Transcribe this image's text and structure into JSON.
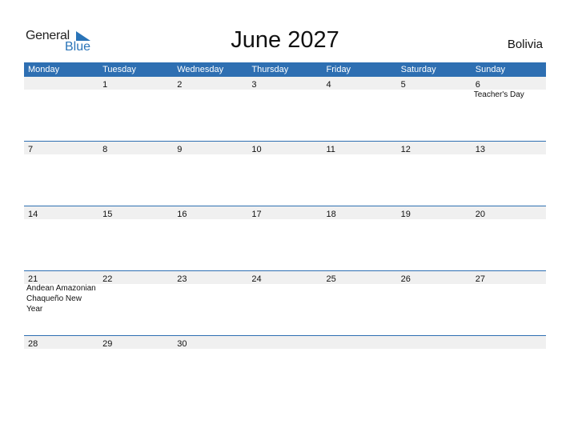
{
  "logo": {
    "general": "General",
    "blue": "Blue"
  },
  "title": "June 2027",
  "country": "Bolivia",
  "accent_color": "#2e6fb2",
  "weekdays": [
    "Monday",
    "Tuesday",
    "Wednesday",
    "Thursday",
    "Friday",
    "Saturday",
    "Sunday"
  ],
  "weeks": [
    {
      "days": [
        "",
        "1",
        "2",
        "3",
        "4",
        "5",
        "6"
      ],
      "events": [
        "",
        "",
        "",
        "",
        "",
        "",
        "Teacher's Day"
      ]
    },
    {
      "days": [
        "7",
        "8",
        "9",
        "10",
        "11",
        "12",
        "13"
      ],
      "events": [
        "",
        "",
        "",
        "",
        "",
        "",
        ""
      ]
    },
    {
      "days": [
        "14",
        "15",
        "16",
        "17",
        "18",
        "19",
        "20"
      ],
      "events": [
        "",
        "",
        "",
        "",
        "",
        "",
        ""
      ]
    },
    {
      "days": [
        "21",
        "22",
        "23",
        "24",
        "25",
        "26",
        "27"
      ],
      "events": [
        "Andean Amazonian Chaqueño New Year",
        "",
        "",
        "",
        "",
        "",
        ""
      ]
    },
    {
      "days": [
        "28",
        "29",
        "30",
        "",
        "",
        "",
        ""
      ],
      "events": [
        "",
        "",
        "",
        "",
        "",
        "",
        ""
      ]
    }
  ]
}
